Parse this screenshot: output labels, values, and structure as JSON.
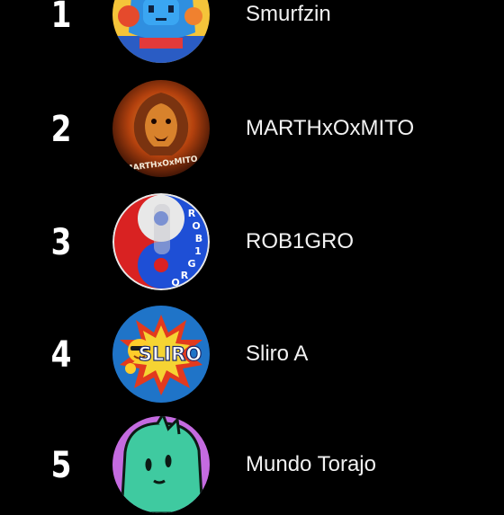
{
  "leaderboard": {
    "entries": [
      {
        "rank": "1",
        "name": "Smurfzin",
        "avatar_icon": "smurfzin-avatar-icon",
        "avatar_colors": [
          "#2f8fe0",
          "#f5c43a"
        ]
      },
      {
        "rank": "2",
        "name": "MARTHxOxMITO",
        "avatar_icon": "lion-logo-icon",
        "avatar_text": "MARTHxOxMITO",
        "avatar_colors": [
          "#3a1206",
          "#e0761c"
        ]
      },
      {
        "rank": "3",
        "name": "ROB1GRO",
        "avatar_icon": "yin-yang-logo-icon",
        "avatar_letters": [
          "R",
          "O",
          "B",
          "1",
          "G",
          "R",
          "O"
        ],
        "avatar_colors": [
          "#d92222",
          "#1e4fd6"
        ]
      },
      {
        "rank": "4",
        "name": "Sliro A",
        "avatar_icon": "sliro-logo-icon",
        "avatar_text": "SLIRO",
        "avatar_colors": [
          "#1f74c8",
          "#e23a1e"
        ]
      },
      {
        "rank": "5",
        "name": "Mundo Torajo",
        "avatar_icon": "cartoon-face-icon",
        "avatar_colors": [
          "#3fcaa0",
          "#c46be0"
        ]
      }
    ]
  }
}
